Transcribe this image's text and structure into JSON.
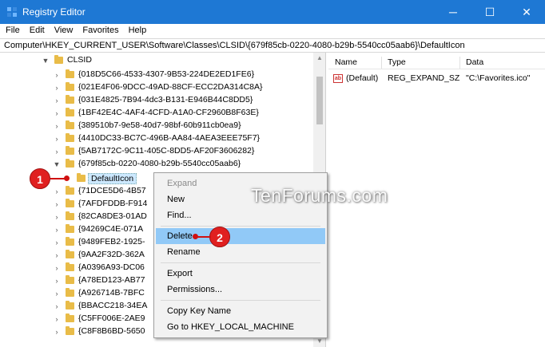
{
  "window": {
    "title": "Registry Editor",
    "controls": {
      "minimize": "─",
      "maximize": "☐",
      "close": "✕"
    }
  },
  "menu": [
    "File",
    "Edit",
    "View",
    "Favorites",
    "Help"
  ],
  "address": "Computer\\HKEY_CURRENT_USER\\Software\\Classes\\CLSID\\{679f85cb-0220-4080-b29b-5540cc05aab6}\\DefaultIcon",
  "tree": {
    "root": "CLSID",
    "items": [
      "{018D5C66-4533-4307-9B53-224DE2ED1FE6}",
      "{021E4F06-9DCC-49AD-88CF-ECC2DA314C8A}",
      "{031E4825-7B94-4dc3-B131-E946B44C8DD5}",
      "{1BF42E4C-4AF4-4CFD-A1A0-CF2960B8F63E}",
      "{389510b7-9e58-40d7-98bf-60b911cb0ea9}",
      "{4410DC33-BC7C-496B-AA84-4AEA3EEE75F7}",
      "{5AB7172C-9C11-405C-8DD5-AF20F3606282}",
      "{679f85cb-0220-4080-b29b-5540cc05aab6}"
    ],
    "selected_child": "DefaultIcon",
    "items_after": [
      "{71DCE5D6-4B57",
      "{7AFDFDDB-F914",
      "{82CA8DE3-01AD",
      "{94269C4E-071A",
      "{9489FEB2-1925-",
      "{9AA2F32D-362A",
      "{A0396A93-DC06",
      "{A78ED123-AB77",
      "{A926714B-7BFC",
      "{BBACC218-34EA",
      "{C5FF006E-2AE9",
      "{C8F8B6BD-5650"
    ]
  },
  "list": {
    "columns": [
      "Name",
      "Type",
      "Data"
    ],
    "rows": [
      {
        "icon": "string-value-icon",
        "icon_text": "ab",
        "name": "(Default)",
        "type": "REG_EXPAND_SZ",
        "data": "\"C:\\Favorites.ico\""
      }
    ]
  },
  "context_menu": {
    "items": [
      "Expand",
      "New",
      "Find...",
      "Delete",
      "Rename",
      "Export",
      "Permissions...",
      "Copy Key Name",
      "Go to HKEY_LOCAL_MACHINE"
    ],
    "disabled_item": "Expand",
    "highlighted_item": "Delete"
  },
  "watermark": "TenForums.com",
  "callouts": [
    "1",
    "2"
  ],
  "colors": {
    "titlebar": "#1e78d4",
    "highlight": "#91c9f7",
    "folder": "#e9bc48",
    "callout": "#e02020"
  }
}
